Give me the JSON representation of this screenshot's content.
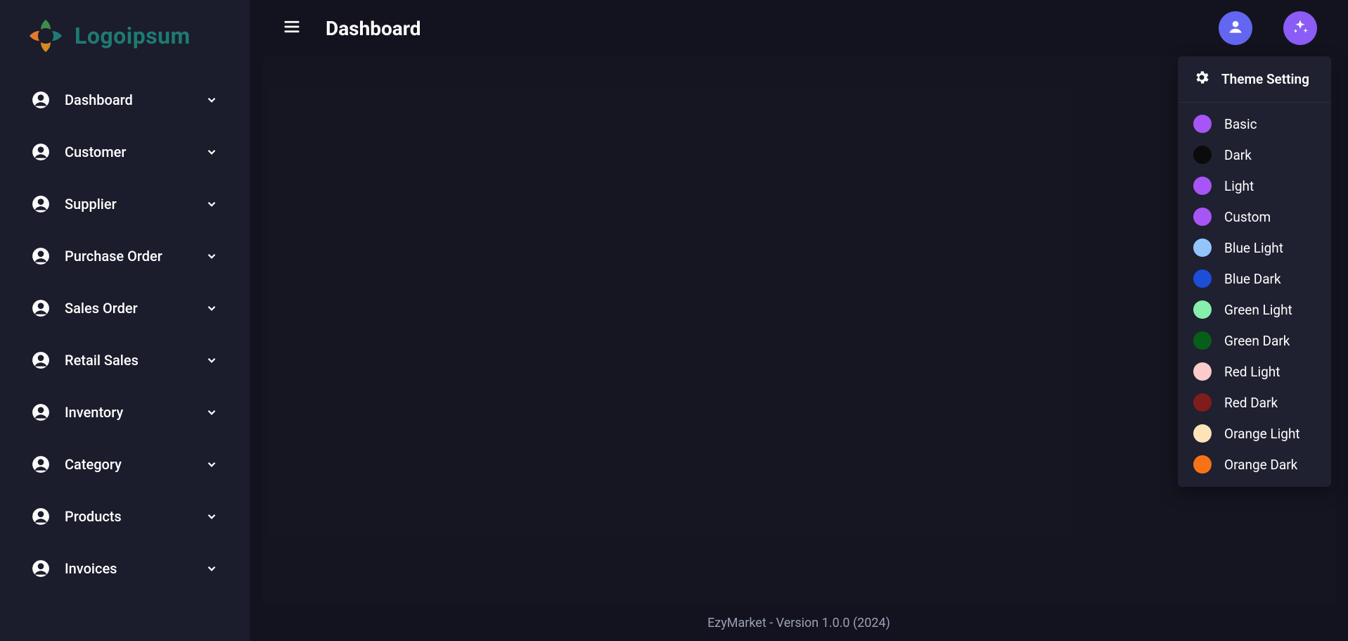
{
  "logo_text": "Logoipsum",
  "header": {
    "title": "Dashboard"
  },
  "sidebar": {
    "items": [
      {
        "label": "Dashboard"
      },
      {
        "label": "Customer"
      },
      {
        "label": "Supplier"
      },
      {
        "label": "Purchase Order"
      },
      {
        "label": "Sales Order"
      },
      {
        "label": "Retail Sales"
      },
      {
        "label": "Inventory"
      },
      {
        "label": "Category"
      },
      {
        "label": "Products"
      },
      {
        "label": "Invoices"
      }
    ]
  },
  "theme_popover": {
    "title": "Theme Setting",
    "themes": [
      {
        "label": "Basic",
        "color": "#a855f7"
      },
      {
        "label": "Dark",
        "color": "#0b0b0b"
      },
      {
        "label": "Light",
        "color": "#a855f7"
      },
      {
        "label": "Custom",
        "color": "#a855f7"
      },
      {
        "label": "Blue Light",
        "color": "#93c5fd"
      },
      {
        "label": "Blue Dark",
        "color": "#1d4ed8"
      },
      {
        "label": "Green Light",
        "color": "#86efac"
      },
      {
        "label": "Green Dark",
        "color": "#065f18"
      },
      {
        "label": "Red Light",
        "color": "#fecaca"
      },
      {
        "label": "Red Dark",
        "color": "#7f1d1d"
      },
      {
        "label": "Orange Light",
        "color": "#fde3b8"
      },
      {
        "label": "Orange Dark",
        "color": "#f97316"
      }
    ]
  },
  "footer": {
    "text": "EzyMarket - Version 1.0.0 (2024)"
  }
}
